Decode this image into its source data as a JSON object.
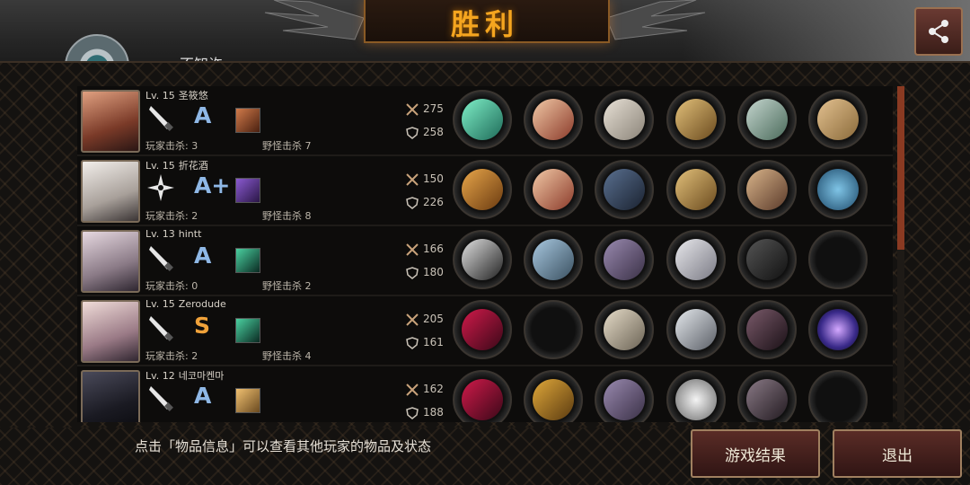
{
  "header": {
    "title": "胜利",
    "player_name": "不知许"
  },
  "players": [
    {
      "level": "Lv. 15",
      "name": "圣筱悠",
      "grade": "A",
      "player_kills": "玩家击杀: 3",
      "monster_kills": "野怪击杀 7",
      "attack": "275",
      "defense": "258",
      "items": [
        "twin-swords-icon",
        "winged-ring-icon",
        "chest-armor-icon",
        "shield-icon",
        "boots-icon",
        "box-icon"
      ]
    },
    {
      "level": "Lv. 15",
      "name": "折花酒",
      "grade": "A+",
      "player_kills": "玩家击杀: 2",
      "monster_kills": "野怪击杀 8",
      "attack": "150",
      "defense": "226",
      "items": [
        "curved-blade-icon",
        "winged-ring-icon",
        "dark-armor-icon",
        "shield-icon",
        "gauntlet-icon",
        "orb-icon"
      ]
    },
    {
      "level": "Lv. 13",
      "name": "hintt",
      "grade": "A",
      "player_kills": "玩家击杀: 0",
      "monster_kills": "野怪击杀 2",
      "attack": "166",
      "defense": "180",
      "items": [
        "scythe-icon",
        "helmet-icon",
        "purple-armor-icon",
        "spiked-blade-icon",
        "dark-boots-icon",
        "empty-slot"
      ]
    },
    {
      "level": "Lv. 15",
      "name": "Zerodude",
      "grade": "S",
      "player_kills": "玩家击杀: 2",
      "monster_kills": "野怪击杀 4",
      "attack": "205",
      "defense": "161",
      "items": [
        "crimson-blade-icon",
        "empty-slot",
        "light-armor-icon",
        "gauntlets-icon",
        "dark-gauntlet-icon",
        "galaxy-orb-icon"
      ]
    },
    {
      "level": "Lv. 12",
      "name": "네코마켄마",
      "grade": "A",
      "player_kills": "",
      "monster_kills": "",
      "attack": "162",
      "defense": "188",
      "items": [
        "crimson-blade-icon",
        "gold-helmet-icon",
        "purple-armor-icon",
        "silver-disc-icon",
        "spotted-boots-icon",
        "empty-slot"
      ]
    }
  ],
  "footer": {
    "hint": "点击「物品信息」可以查看其他玩家的物品及状态",
    "results_button": "游戏结果",
    "exit_button": "退出"
  },
  "colors": {
    "title": "#f5a51f",
    "accent_border": "#a08060",
    "button_fill": "#5a2c26",
    "grade_a": "#8fb8e6",
    "grade_s": "#f0a23a"
  }
}
